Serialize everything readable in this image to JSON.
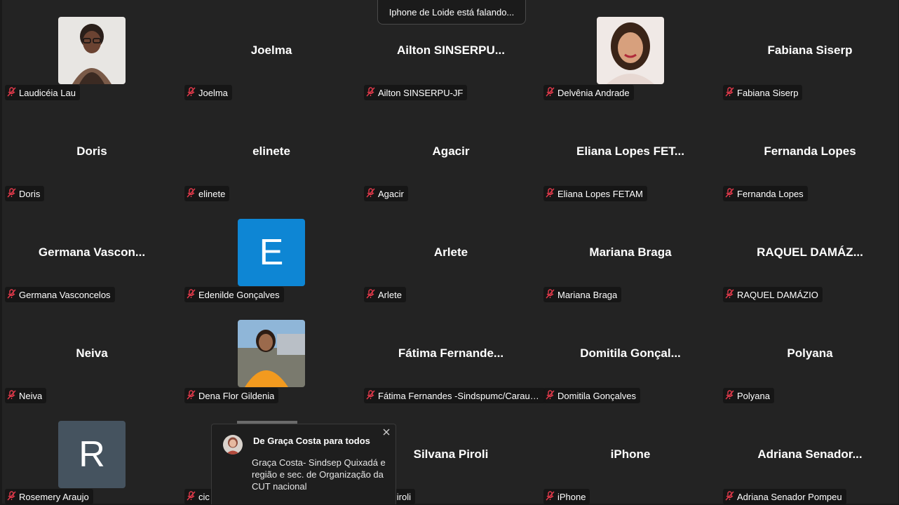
{
  "speaking_banner": "Iphone de Loide está falando...",
  "colors": {
    "grid_background": "#232323",
    "mute_icon": "#e0394a",
    "avatar_blue": "#0e86d4",
    "avatar_slate": "#45535f"
  },
  "participants": [
    {
      "display": "",
      "label": "Laudicéia Lau",
      "avatar": "photo",
      "muted": true
    },
    {
      "display": "Joelma",
      "label": "Joelma",
      "muted": true
    },
    {
      "display": "Ailton  SINSERPU...",
      "label": "Ailton SINSERPU-JF",
      "muted": true
    },
    {
      "display": "",
      "label": "Delvênia Andrade",
      "avatar": "photo",
      "muted": true
    },
    {
      "display": "Fabiana Siserp",
      "label": "Fabiana Siserp",
      "muted": true
    },
    {
      "display": "Doris",
      "label": "Doris",
      "muted": true
    },
    {
      "display": "elinete",
      "label": "elinete",
      "muted": true
    },
    {
      "display": "Agacir",
      "label": "Agacir",
      "muted": true
    },
    {
      "display": "Eliana  Lopes  FET...",
      "label": "Eliana Lopes FETAM",
      "muted": true
    },
    {
      "display": "Fernanda Lopes",
      "label": "Fernanda Lopes",
      "muted": true
    },
    {
      "display": "Germana  Vascon...",
      "label": "Germana Vasconcelos",
      "muted": true
    },
    {
      "display": "",
      "label": "Edenilde Gonçalves",
      "avatar": "letter",
      "letter": "E",
      "avatar_color": "#0e86d4",
      "muted": true
    },
    {
      "display": "Arlete",
      "label": "Arlete",
      "muted": true
    },
    {
      "display": "Mariana Braga",
      "label": "Mariana Braga",
      "muted": true
    },
    {
      "display": "RAQUEL  DAMÁZ...",
      "label": "RAQUEL DAMÁZIO",
      "muted": true
    },
    {
      "display": "Neiva",
      "label": "Neiva",
      "muted": true
    },
    {
      "display": "",
      "label": "Dena Flor Gildenia",
      "avatar": "photo",
      "muted": true
    },
    {
      "display": "Fátima  Fernande...",
      "label": "Fátima Fernandes -Sindspumc/Caraub...",
      "muted": true
    },
    {
      "display": "Domitila  Gonçal...",
      "label": "Domitila Gonçalves",
      "muted": true
    },
    {
      "display": "Polyana",
      "label": "Polyana",
      "muted": true
    },
    {
      "display": "",
      "label": "Rosemery Araujo",
      "avatar": "letter",
      "letter": "R",
      "avatar_color": "#45535f",
      "muted": true
    },
    {
      "display": "",
      "label": "cic",
      "muted": true
    },
    {
      "display": "Silvana Piroli",
      "label": "na Piroli",
      "muted": true
    },
    {
      "display": "iPhone",
      "label": "iPhone",
      "muted": true
    },
    {
      "display": "Adriana  Senador...",
      "label": "Adriana Senador Pompeu",
      "muted": true
    }
  ],
  "chat_popup": {
    "sender": "De Graça Costa para todos",
    "message": "Graça Costa- Sindsep Quixadá e região e sec. de Organização da CUT nacional"
  }
}
